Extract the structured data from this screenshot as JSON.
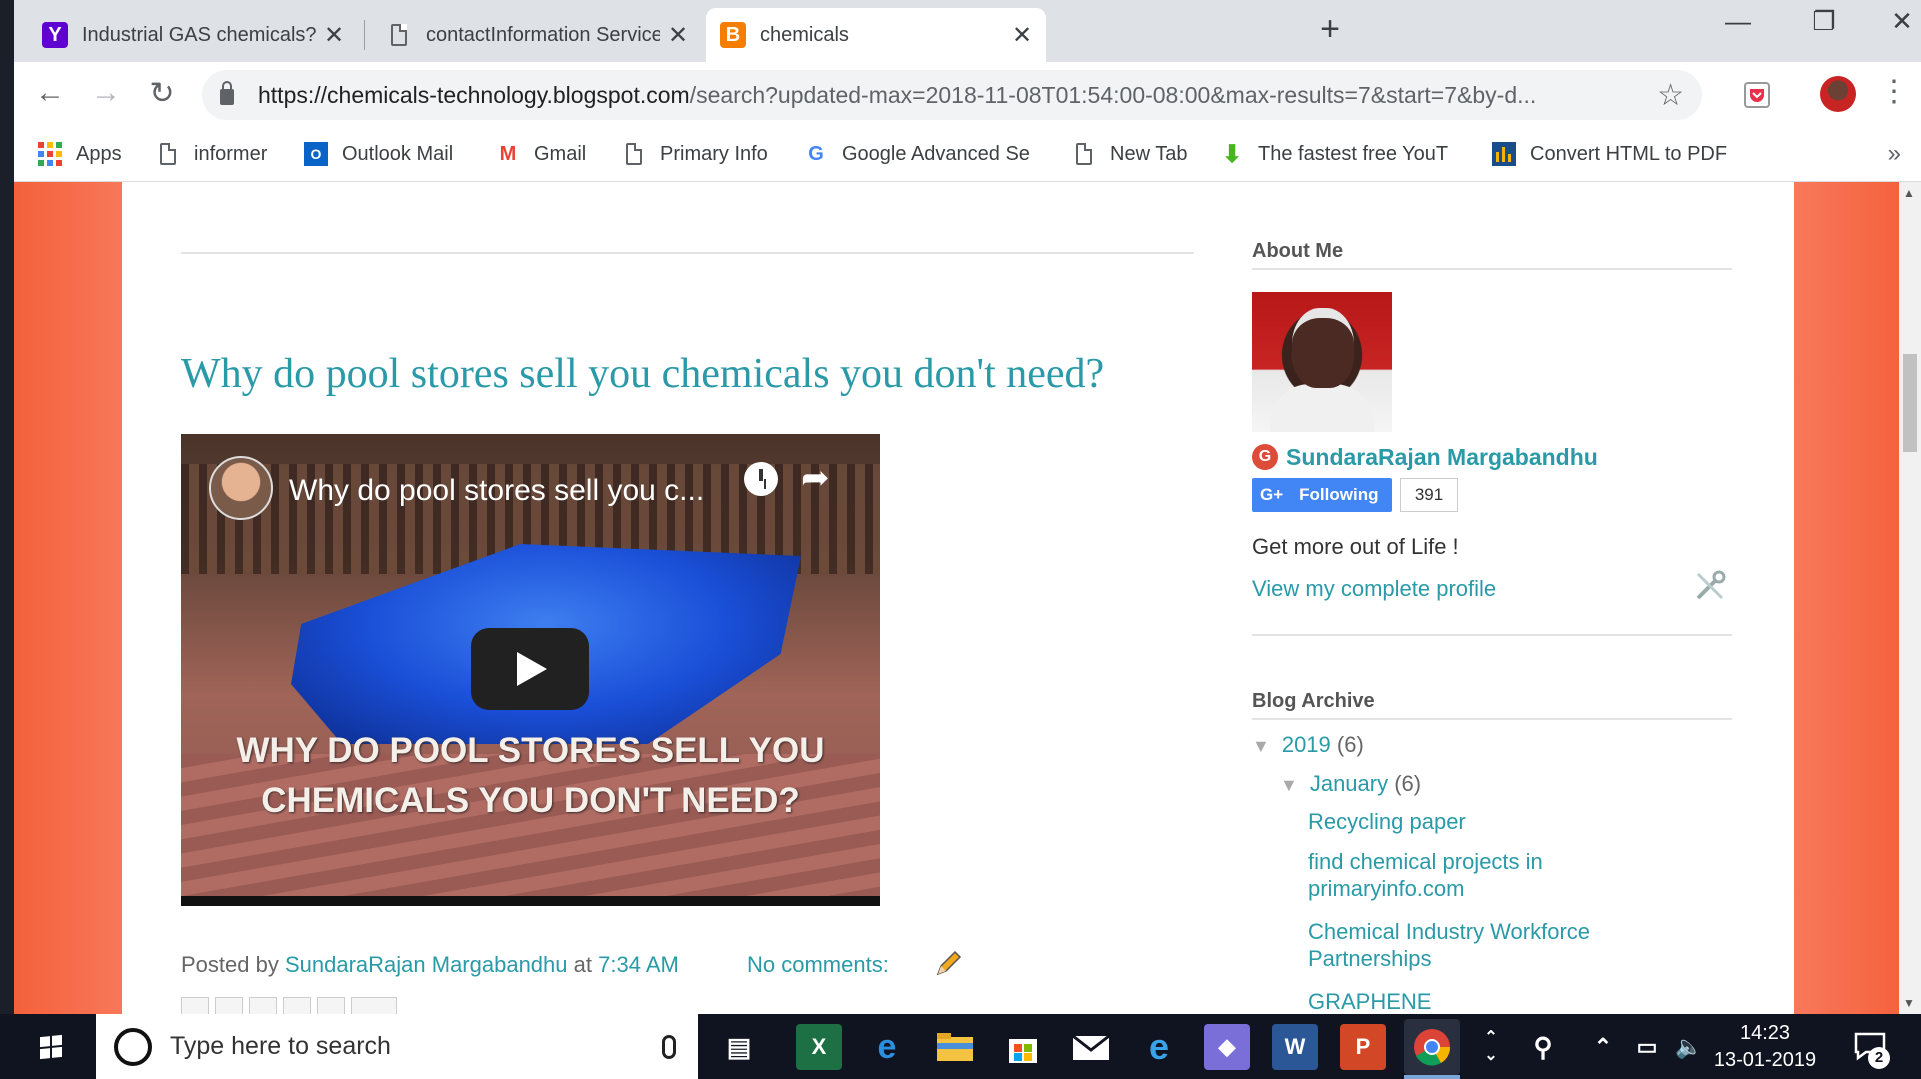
{
  "browser": {
    "tabs": [
      {
        "title": "Industrial GAS chemicals? market",
        "favicon": "Y",
        "favicon_color": "#5f01d1",
        "active": false
      },
      {
        "title": "contactInformation Services Sma",
        "favicon": "doc-icon",
        "active": false
      },
      {
        "title": "chemicals",
        "favicon": "blogger-icon",
        "favicon_color": "#f57d00",
        "active": true
      }
    ],
    "close_glyph": "✕",
    "new_tab_glyph": "+",
    "window_controls": {
      "minimize": "—",
      "restore": "❐",
      "close": "✕"
    },
    "url_host": "https://chemicals-technology.blogspot.com",
    "url_path": "/search?updated-max=2018-11-08T01:54:00-08:00&max-results=7&start=7&by-d...",
    "bookmarks": [
      {
        "label": "Apps",
        "icon": "apps-grid-icon"
      },
      {
        "label": "informer",
        "icon": "doc-icon"
      },
      {
        "label": "Outlook Mail",
        "icon": "outlook-icon"
      },
      {
        "label": "Gmail",
        "icon": "gmail-icon"
      },
      {
        "label": "Primary Info",
        "icon": "doc-icon"
      },
      {
        "label": "Google Advanced Se",
        "icon": "google-icon"
      },
      {
        "label": "New Tab",
        "icon": "doc-icon"
      },
      {
        "label": "The fastest free YouT",
        "icon": "download-arrow-icon"
      },
      {
        "label": "Convert HTML to PDF",
        "icon": "bar-chart-icon"
      }
    ],
    "bookmarks_more": "»"
  },
  "post": {
    "title": "Why do pool stores sell you chemicals you don't need?",
    "video": {
      "title": "Why do pool stores sell you c...",
      "caption_line1": "WHY DO POOL STORES SELL YOU",
      "caption_line2": "CHEMICALS YOU DON'T NEED?"
    },
    "posted_by_label": "Posted by",
    "author": "SundaraRajan Margabandhu",
    "at_label": "at",
    "time": "7:34 AM",
    "comments": "No comments:"
  },
  "sidebar": {
    "about_heading": "About Me",
    "profile_name": "SundaraRajan Margabandhu",
    "following_label": "Following",
    "follower_count": "391",
    "tagline": "Get more out of Life !",
    "view_profile": "View my complete profile",
    "archive_heading": "Blog Archive",
    "archive_year": "2019",
    "archive_year_count": "(6)",
    "archive_month": "January",
    "archive_month_count": "(6)",
    "archive_posts": [
      "Recycling paper",
      "find chemical projects in primaryinfo.com",
      "Chemical Industry Workforce Partnerships",
      "GRAPHENE"
    ]
  },
  "taskbar": {
    "search_placeholder": "Type here to search",
    "time": "14:23",
    "date": "13-01-2019",
    "notification_count": "2"
  },
  "colors": {
    "link": "#2a9aa8",
    "page_background": "#f8785b",
    "chrome_tabstrip": "#dee1e6",
    "taskbar": "#101320"
  }
}
